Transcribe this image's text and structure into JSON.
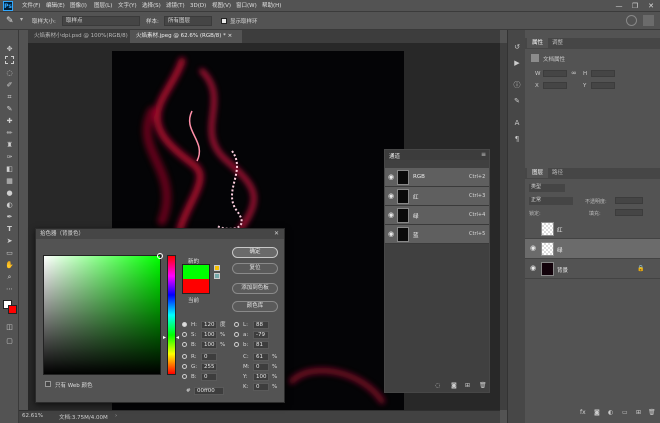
{
  "menu": {
    "logo": "Ps",
    "items": [
      "文件(F)",
      "编辑(E)",
      "图像(I)",
      "图层(L)",
      "文字(Y)",
      "选择(S)",
      "滤镜(T)",
      "3D(D)",
      "视图(V)",
      "窗口(W)",
      "帮助(H)"
    ],
    "window_controls": [
      "—",
      "❐",
      "✕"
    ]
  },
  "options": {
    "sample_size_label": "取样大小:",
    "sample_size_value": "取样点",
    "sample_label": "样本:",
    "sample_value": "所有图层",
    "show_ring_label": "显示取样环"
  },
  "tabs": [
    {
      "label": "火焰素材小dpi.psd @ 100%(RGB/8) ×"
    },
    {
      "label": "火焰素材.jpeg @ 62.6% (RGB/8) * ×"
    }
  ],
  "tools": [
    "move",
    "marquee",
    "lasso",
    "quick-select",
    "crop",
    "eyedropper",
    "healing",
    "brush",
    "stamp",
    "history-brush",
    "eraser",
    "gradient",
    "blur",
    "dodge",
    "pen",
    "type",
    "path-select",
    "shape",
    "hand",
    "zoom",
    "more",
    "fg-bg",
    "quickmask",
    "screen-mode"
  ],
  "status": {
    "zoom": "62.61%",
    "doc": "文档:3.75M/4.00M"
  },
  "properties": {
    "tabs": [
      "属性",
      "调整"
    ],
    "doc_label": "文档属性",
    "w_label": "W",
    "h_label": "H",
    "x_label": "X",
    "y_label": "Y"
  },
  "channels": {
    "title": "通道",
    "rows": [
      {
        "name": "RGB",
        "key": "Ctrl+2"
      },
      {
        "name": "红",
        "key": "Ctrl+3"
      },
      {
        "name": "绿",
        "key": "Ctrl+4"
      },
      {
        "name": "蓝",
        "key": "Ctrl+5"
      }
    ]
  },
  "layers": {
    "tabs": [
      "图层",
      "路径"
    ],
    "kind_label": "类型",
    "blend_mode": "正常",
    "opacity_label": "不透明度:",
    "lock_label": "锁定:",
    "fill_label": "填充:",
    "rows": [
      {
        "name": "红"
      },
      {
        "name": "绿"
      },
      {
        "name": "背景"
      }
    ]
  },
  "picker": {
    "title": "拾色器（背景色）",
    "new_label": "新的",
    "current_label": "当前",
    "buttons": [
      "确定",
      "复位",
      "添加到色板",
      "颜色库"
    ],
    "fields": {
      "H": {
        "label": "H:",
        "value": "120",
        "unit": "度"
      },
      "S": {
        "label": "S:",
        "value": "100",
        "unit": "%"
      },
      "B": {
        "label": "B:",
        "value": "100",
        "unit": "%"
      },
      "R": {
        "label": "R:",
        "value": "0",
        "unit": ""
      },
      "G": {
        "label": "G:",
        "value": "255",
        "unit": ""
      },
      "Bl": {
        "label": "B:",
        "value": "0",
        "unit": ""
      },
      "L": {
        "label": "L:",
        "value": "88",
        "unit": ""
      },
      "a": {
        "label": "a:",
        "value": "-79",
        "unit": ""
      },
      "b": {
        "label": "b:",
        "value": "81",
        "unit": ""
      },
      "C": {
        "label": "C:",
        "value": "61",
        "unit": "%"
      },
      "M": {
        "label": "M:",
        "value": "0",
        "unit": "%"
      },
      "Y": {
        "label": "Y:",
        "value": "100",
        "unit": "%"
      },
      "K": {
        "label": "K:",
        "value": "0",
        "unit": "%"
      }
    },
    "hex_label": "#",
    "hex_value": "00ff00",
    "web_only_label": "只有 Web 颜色"
  },
  "colors": {
    "new": "#00ff00",
    "current": "#ff0000",
    "accent": "#31a8ff"
  }
}
